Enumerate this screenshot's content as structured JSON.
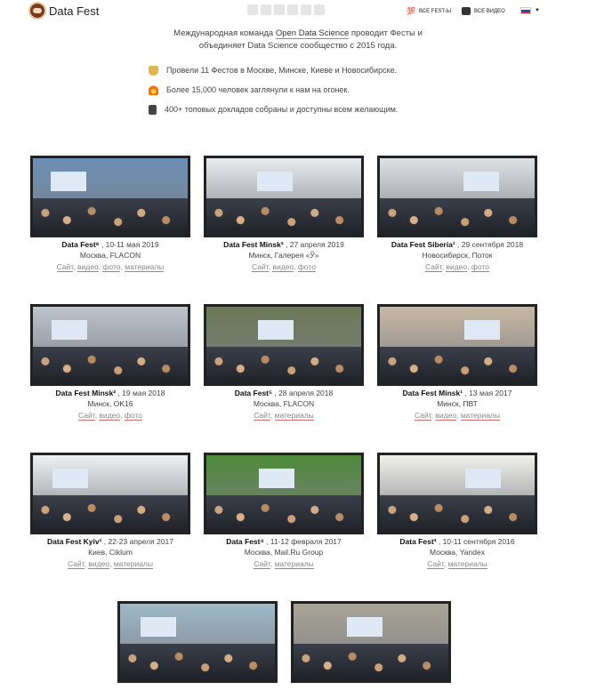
{
  "header": {
    "brand": "Data Fest",
    "nav_fests": "ВСЕ FEST-Ы",
    "nav_fests_icon": "💯",
    "nav_video": "ВСЕ ВИДЕО",
    "nav_lang": "ru-flag"
  },
  "intro": {
    "line1_pre": "Международная команда ",
    "line1_link": "Open Data Science",
    "line1_post": " проводит Фесты и",
    "line2": "объединяет Data Science сообщество с 2015 года."
  },
  "facts": [
    {
      "icon": "trophy-icon",
      "text": "Провели 11 Фестов в Москве, Минске, Киеве и Новосибирске."
    },
    {
      "icon": "fire-icon",
      "text": "Более 15,000 человек заглянули к нам на огонек."
    },
    {
      "icon": "books-icon",
      "text": "400+ топовых докладов собраны и доступны всем желающим."
    }
  ],
  "events": [
    {
      "title": "Data Fest⁶",
      "date": " , 10-11 мая 2019",
      "venue": "Москва, FLACON",
      "links": [
        "Сайт",
        "видео",
        "фото",
        "материалы"
      ],
      "palette": "#6c8fb5"
    },
    {
      "title": "Data Fest Minsk³",
      "date": " , 27 апреля 2019",
      "venue": "Минск, Галерея «Ў»",
      "links": [
        "Сайт",
        "видео",
        "фото"
      ],
      "palette": "#e8ecef"
    },
    {
      "title": "Data Fest Siberia¹",
      "date": " , 29 сентября 2018",
      "venue": "Новосибирск, Поток",
      "links": [
        "Сайт",
        "видео",
        "фото"
      ],
      "palette": "#e0e3e6"
    },
    {
      "title": "Data Fest Minsk²",
      "date": " , 19 мая 2018",
      "venue": "Минск, OK16",
      "links": [
        "Сайт",
        "видео",
        "фото"
      ],
      "palette": "#bcc4cc"
    },
    {
      "title": "Data Fest⁵",
      "date": " , 28 апреля 2018",
      "venue": "Москва, FLACON",
      "links": [
        "Сайт",
        "материалы"
      ],
      "palette": "#6a7a57"
    },
    {
      "title": "Data Fest Minsk¹",
      "date": " , 13 мая 2017",
      "venue": "Минск, ПВТ",
      "links": [
        "Сайт",
        "видео",
        "материалы"
      ],
      "palette": "#c7b8a3"
    },
    {
      "title": "Data Fest Kyiv¹",
      "date": " , 22-23 апреля 2017",
      "venue": "Киев, Ciklum",
      "links": [
        "Сайт",
        "видео",
        "материалы"
      ],
      "palette": "#eef1f4"
    },
    {
      "title": "Data Fest⁴",
      "date": " , 11-12 февраля 2017",
      "venue": "Москва, Mail.Ru Group",
      "links": [
        "Сайт",
        "материалы"
      ],
      "palette": "#4f8a3a"
    },
    {
      "title": "Data Fest³",
      "date": " , 10-11 сентября 2016",
      "venue": "Москва, Yandex",
      "links": [
        "Сайт",
        "материалы"
      ],
      "palette": "#f1f1ec"
    },
    {
      "title": "",
      "date": "",
      "venue": "",
      "links": [],
      "palette": "#9fb9c9"
    },
    {
      "title": "",
      "date": "",
      "venue": "",
      "links": [],
      "palette": "#a9a497"
    }
  ]
}
